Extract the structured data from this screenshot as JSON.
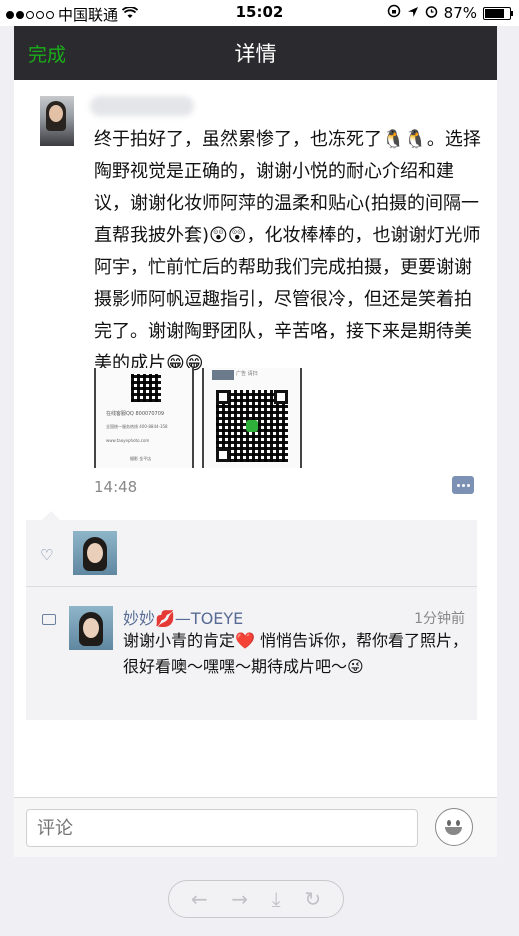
{
  "status_bar": {
    "carrier": "中国联通",
    "time": "15:02",
    "battery": "87%",
    "battery_level": 0.87,
    "icons": [
      "signal-dots-icon",
      "wifi-icon",
      "rotation-lock-icon",
      "location-icon",
      "alarm-icon",
      "battery-icon"
    ]
  },
  "navbar": {
    "done_label": "完成",
    "title": "详情"
  },
  "post": {
    "text": "终于拍好了，虽然累惨了，也冻死了🐧🐧。选择陶野视觉是正确的，谢谢小悦的耐心介绍和建议，谢谢化妆师阿萍的温柔和贴心(拍摄的间隔一直帮我披外套)😲😲，化妆棒棒的，也谢谢灯光师阿宇，忙前忙后的帮助我们完成拍摄，更要谢谢摄影师阿帆逗趣指引，尽管很冷，但还是笑着拍完了。谢谢陶野团队，辛苦咯，接下来是期待美美的成片😁😁",
    "time": "14:48",
    "image_1_text": {
      "line1": "在线客服QQ 800070709",
      "line2": "全国统一服务热线 400-8844-358",
      "line3": "www.taoyephoto.com",
      "line4": "摄影 金平店"
    },
    "image_2_text": "广告 请扫"
  },
  "interactions": {
    "comment": {
      "author": "妙妙💋—TOEYE",
      "time": "1分钟前",
      "text": "谢谢小青的肯定❤️ 悄悄告诉你，帮你看了照片，很好看噢～嘿嘿～期待成片吧～😜"
    }
  },
  "input": {
    "placeholder": "评论"
  },
  "browser_toolbar": {
    "back": "←",
    "forward": "→",
    "download": "⤓",
    "refresh": "↻"
  },
  "colors": {
    "navbar_bg": "#2b2b2f",
    "done_green": "#1aad19",
    "name_blue": "#576b95"
  }
}
